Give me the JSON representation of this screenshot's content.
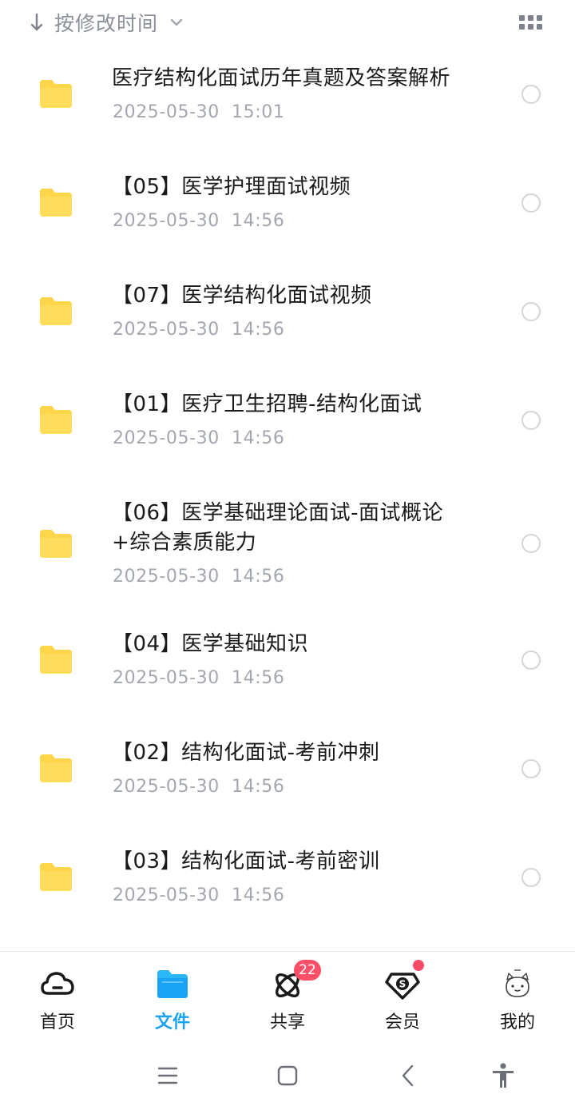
{
  "sort": {
    "label": "按修改时间",
    "arrow_icon": "arrow-down-icon",
    "chevron_icon": "chevron-down-icon",
    "view_toggle_icon": "grid-view-icon"
  },
  "files": [
    {
      "name": "医疗结构化面试历年真题及答案解析",
      "date": "2025-05-30  15:01",
      "icon": "folder-icon"
    },
    {
      "name": "【05】医学护理面试视频",
      "date": "2025-05-30  14:56",
      "icon": "folder-icon"
    },
    {
      "name": "【07】医学结构化面试视频",
      "date": "2025-05-30  14:56",
      "icon": "folder-icon"
    },
    {
      "name": "【01】医疗卫生招聘-结构化面试",
      "date": "2025-05-30  14:56",
      "icon": "folder-icon"
    },
    {
      "name": "【06】医学基础理论面试-面试概论+综合素质能力",
      "date": "2025-05-30  14:56",
      "icon": "folder-icon"
    },
    {
      "name": "【04】医学基础知识",
      "date": "2025-05-30  14:56",
      "icon": "folder-icon"
    },
    {
      "name": "【02】结构化面试-考前冲刺",
      "date": "2025-05-30  14:56",
      "icon": "folder-icon"
    },
    {
      "name": "【03】结构化面试-考前密训",
      "date": "2025-05-30  14:56",
      "icon": "folder-icon"
    }
  ],
  "tabs": [
    {
      "label": "首页",
      "icon": "cloud-icon",
      "active": false
    },
    {
      "label": "文件",
      "icon": "folder-icon",
      "active": true
    },
    {
      "label": "共享",
      "icon": "atom-icon",
      "active": false,
      "badge": "22"
    },
    {
      "label": "会员",
      "icon": "vip-shield-icon",
      "active": false,
      "dot": true
    },
    {
      "label": "我的",
      "icon": "avatar-icon",
      "active": false
    }
  ],
  "system_nav": [
    "menu-icon",
    "home-square-icon",
    "back-icon",
    "accessibility-icon"
  ],
  "colors": {
    "accent": "#1aa3f2",
    "folder": "#ffd54a",
    "badge": "#fc5068",
    "muted_text": "#a3a7ae"
  }
}
